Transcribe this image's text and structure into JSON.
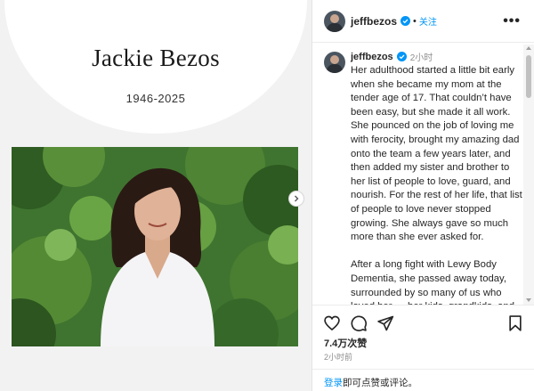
{
  "memorial": {
    "name": "Jackie Bezos",
    "years": "1946-2025"
  },
  "header": {
    "username": "jeffbezos",
    "separator": "•",
    "follow_label": "关注",
    "more_label": "•••"
  },
  "caption": {
    "username": "jeffbezos",
    "time": "2小时",
    "text": "Her adulthood started a little bit early when she became my mom at the tender age of 17. That couldn’t have been easy, but she made it all work. She pounced on the job of loving me with ferocity, brought my amazing dad onto the team a few years later, and then added my sister and brother to her list of people to love, guard, and nourish. For the rest of her life, that list of people to love never stopped growing. She always gave so much more than she ever asked for.\n\nAfter a long fight with Lewy Body Dementia, she passed away today, surrounded by so many of us who loved her — her kids, grandkids, and my dad. I know she felt our love in those final moments. We were all so"
  },
  "stats": {
    "likes": "7.4万次赞",
    "time_ago": "2小时前"
  },
  "login": {
    "link": "登录",
    "rest": "即可点赞或评论。"
  },
  "icons": {
    "verified": "verified-badge-icon",
    "like": "heart-icon",
    "comment": "comment-icon",
    "share": "paper-plane-icon",
    "save": "bookmark-icon",
    "next": "chevron-right-icon"
  },
  "colors": {
    "accent": "#0095f6",
    "text": "#262626",
    "muted": "#8e8e8e"
  }
}
